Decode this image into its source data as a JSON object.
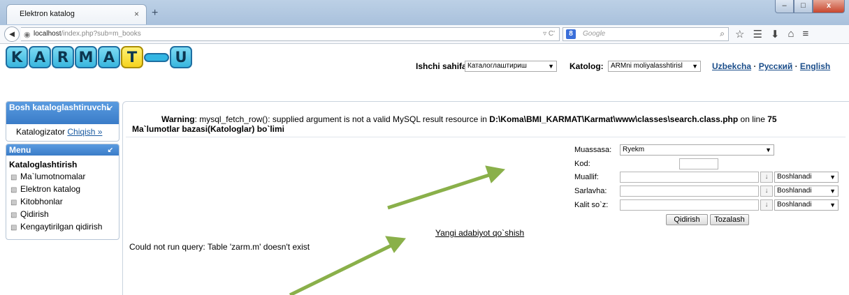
{
  "browser": {
    "tab_title": "Elektron katalog",
    "tab_close": "×",
    "new_tab": "+",
    "window_buttons": {
      "minimize": "–",
      "maximize": "□",
      "close": "x"
    },
    "back": "◄",
    "url_host": "localhost",
    "url_path": "/index.php?sub=m_books",
    "url_arrows": "▿ C'",
    "search_engine": "8",
    "search_placeholder": "Google",
    "search_mag": "⌕",
    "toolbar_icons": [
      "☆",
      "☰",
      "⬇",
      "⌂",
      "≡"
    ]
  },
  "logo": {
    "letters": [
      "K",
      "A",
      "R",
      "M",
      "A",
      "T",
      "U"
    ],
    "colors": {
      "blue": "#38b6de",
      "yellow": "#f6d31d"
    }
  },
  "header": {
    "ishchi_label": "Ishchi sahifa:",
    "ishchi_value": "Каталоглаштириш",
    "katalog_label": "Katolog:",
    "katalog_value": "ARMni moliyalasshtirisl",
    "lang_uz": "Uzbekcha",
    "lang_ru": "Русский",
    "lang_en": "English",
    "lang_sep": "·"
  },
  "sidebar": {
    "bosh_title": "Bosh kataloglashtiruvchi",
    "user": "Katalogizator",
    "logout": "Chiqish »",
    "menu_title": "Menu",
    "menu_section": "Kataloglashtirish",
    "items": [
      {
        "label": "Ma`lumotnomalar"
      },
      {
        "label": "Elektron katalog"
      },
      {
        "label": "Kitobhonlar"
      },
      {
        "label": "Qidirish"
      },
      {
        "label": "Kengaytirilgan qidirish"
      }
    ]
  },
  "content": {
    "warning_prefix": "Warning",
    "warning_text": ": mysql_fetch_row(): supplied argument is not a valid MySQL result resource in ",
    "warning_path": "D:\\Koma\\BMI_KARMAT\\Karmat\\www\\classes\\search.class.php",
    "warning_online": " on line ",
    "warning_line": "75",
    "section_title": "Ma`lumotlar bazasi(Katologlar) bo`limi",
    "form": {
      "muassasa_label": "Muassasa:",
      "muassasa_value": "Ryekm",
      "kod_label": "Kod:",
      "muallif_label": "Muallif:",
      "sarlavha_label": "Sarlavha:",
      "kalit_label": "Kalit so`z:",
      "mode_value": "Boshlanadi",
      "down_glyph": "↓",
      "search_button": "Qidirish",
      "clear_button": "Tozalash"
    },
    "new_lit_link": "Yangi adabiyot qo`shish",
    "query_error": "Could not run query: Table 'zarm.m' doesn't exist"
  },
  "annotations": {
    "arrow_color": "#8ab04a"
  }
}
